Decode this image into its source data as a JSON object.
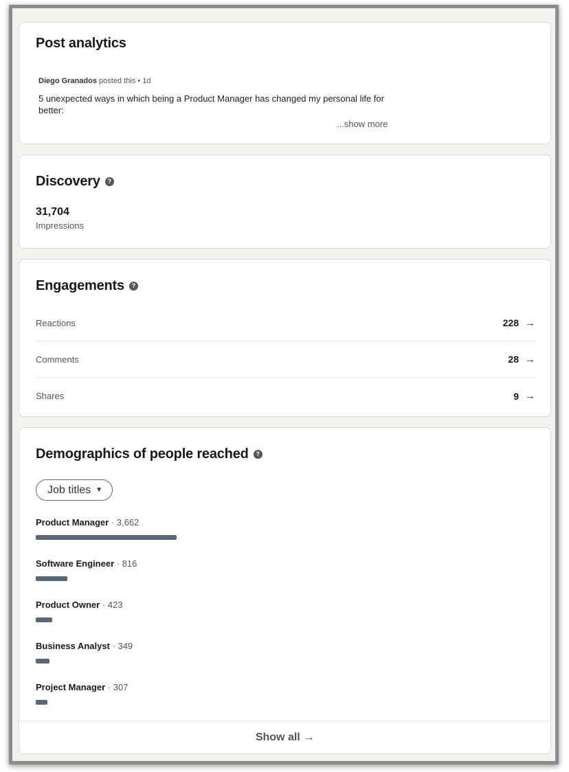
{
  "post_analytics": {
    "title": "Post analytics",
    "author": "Diego Granados",
    "meta_suffix": " posted this • 1d",
    "text": "5 unexpected ways in which being a Product Manager has changed my personal life for better:",
    "show_more": "...show more"
  },
  "discovery": {
    "title": "Discovery",
    "help_icon": "?",
    "impressions_value": "31,704",
    "impressions_label": "Impressions"
  },
  "engagements": {
    "title": "Engagements",
    "help_icon": "?",
    "rows": [
      {
        "label": "Reactions",
        "count": "228",
        "arrow": "→"
      },
      {
        "label": "Comments",
        "count": "28",
        "arrow": "→"
      },
      {
        "label": "Shares",
        "count": "9",
        "arrow": "→"
      }
    ]
  },
  "demographics": {
    "title": "Demographics of people reached",
    "help_icon": "?",
    "dropdown_label": "Job titles",
    "dropdown_caret": "▼",
    "bar_color": "#56687a",
    "items": [
      {
        "name": "Product Manager",
        "count": "3,662",
        "value": 3662
      },
      {
        "name": "Software Engineer",
        "count": "816",
        "value": 816
      },
      {
        "name": "Product Owner",
        "count": "423",
        "value": 423
      },
      {
        "name": "Business Analyst",
        "count": "349",
        "value": 349
      },
      {
        "name": "Project Manager",
        "count": "307",
        "value": 307
      }
    ],
    "show_all": "Show all →"
  }
}
